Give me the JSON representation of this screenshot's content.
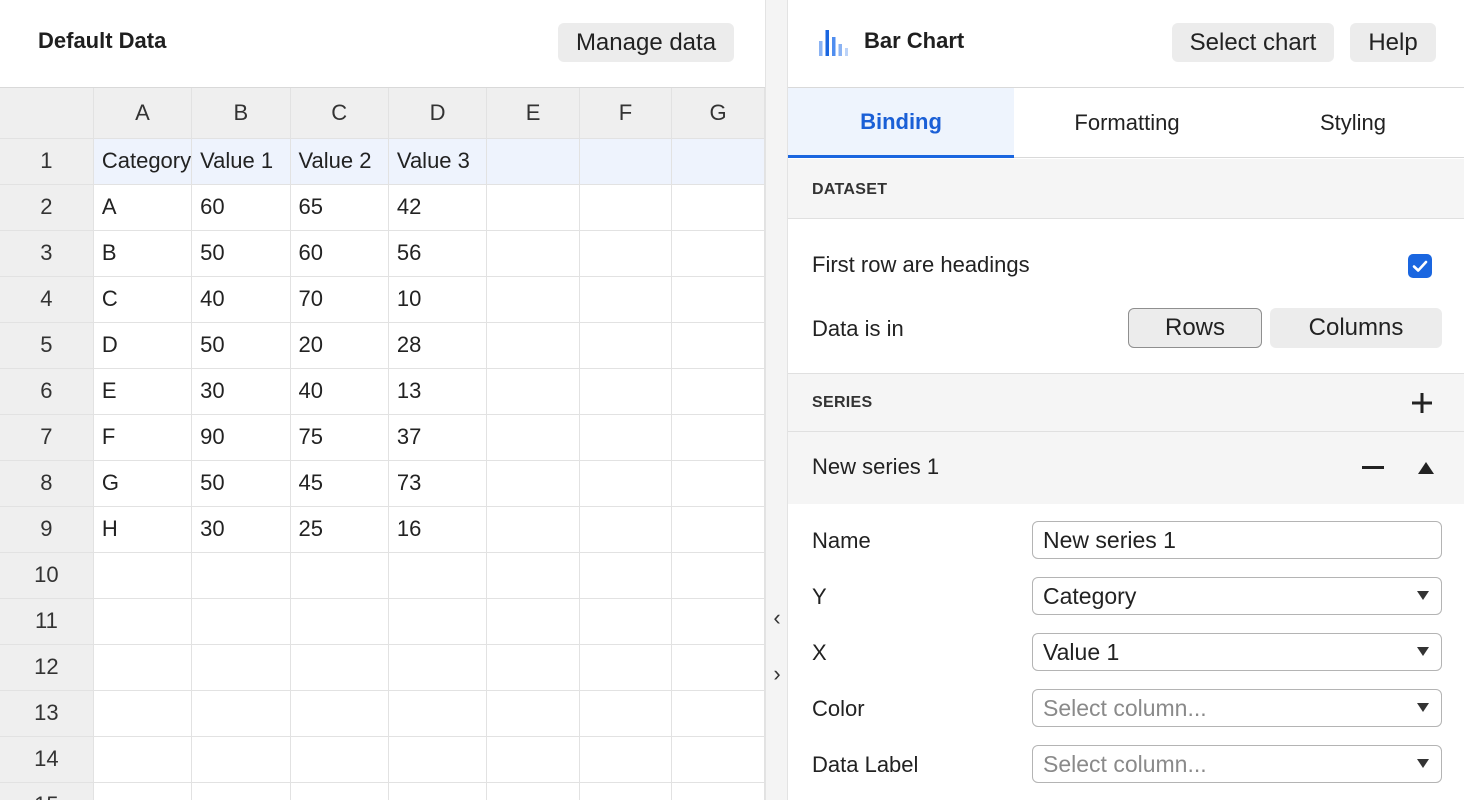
{
  "left": {
    "title": "Default Data",
    "manage_label": "Manage data"
  },
  "grid": {
    "columns": [
      "A",
      "B",
      "C",
      "D",
      "E",
      "F",
      "G"
    ],
    "row_numbers": [
      "1",
      "2",
      "3",
      "4",
      "5",
      "6",
      "7",
      "8",
      "9",
      "10",
      "11",
      "12",
      "13",
      "14",
      "15"
    ],
    "rows": [
      [
        "Category",
        "Value 1",
        "Value 2",
        "Value 3",
        "",
        "",
        ""
      ],
      [
        "A",
        "60",
        "65",
        "42",
        "",
        "",
        ""
      ],
      [
        "B",
        "50",
        "60",
        "56",
        "",
        "",
        ""
      ],
      [
        "C",
        "40",
        "70",
        "10",
        "",
        "",
        ""
      ],
      [
        "D",
        "50",
        "20",
        "28",
        "",
        "",
        ""
      ],
      [
        "E",
        "30",
        "40",
        "13",
        "",
        "",
        ""
      ],
      [
        "F",
        "90",
        "75",
        "37",
        "",
        "",
        ""
      ],
      [
        "G",
        "50",
        "45",
        "73",
        "",
        "",
        ""
      ],
      [
        "H",
        "30",
        "25",
        "16",
        "",
        "",
        ""
      ],
      [
        "",
        "",
        "",
        "",
        "",
        "",
        ""
      ],
      [
        "",
        "",
        "",
        "",
        "",
        "",
        ""
      ],
      [
        "",
        "",
        "",
        "",
        "",
        "",
        ""
      ],
      [
        "",
        "",
        "",
        "",
        "",
        "",
        ""
      ],
      [
        "",
        "",
        "",
        "",
        "",
        "",
        ""
      ],
      [
        "",
        "",
        "",
        "",
        "",
        "",
        ""
      ]
    ]
  },
  "divider": {
    "collapse_icon": "chevron-left-icon",
    "expand_icon": "chevron-right-icon"
  },
  "right": {
    "chart_icon": "bar-chart-icon",
    "chart_name": "Bar Chart",
    "select_chart_label": "Select chart",
    "help_label": "Help",
    "tabs": [
      {
        "label": "Binding",
        "active": true
      },
      {
        "label": "Formatting",
        "active": false
      },
      {
        "label": "Styling",
        "active": false
      }
    ],
    "dataset": {
      "heading": "DATASET",
      "first_row_label": "First row are headings",
      "first_row_checked": true,
      "data_is_in_label": "Data is in",
      "rows_label": "Rows",
      "columns_label": "Columns",
      "selected": "Rows"
    },
    "series": {
      "heading": "SERIES",
      "add_icon": "plus-icon",
      "items": [
        {
          "title": "New series 1",
          "remove_icon": "minus-icon",
          "collapse_icon": "caret-up-icon",
          "name_label": "Name",
          "name_value": "New series 1",
          "y_label": "Y",
          "y_value": "Category",
          "x_label": "X",
          "x_value": "Value 1",
          "color_label": "Color",
          "color_placeholder": "Select column...",
          "data_label_label": "Data Label",
          "data_label_placeholder": "Select column..."
        }
      ]
    }
  },
  "colors": {
    "accent": "#1a66e0",
    "active_tab_bg": "#eef4fd",
    "header_row_bg": "#eef3fd"
  }
}
